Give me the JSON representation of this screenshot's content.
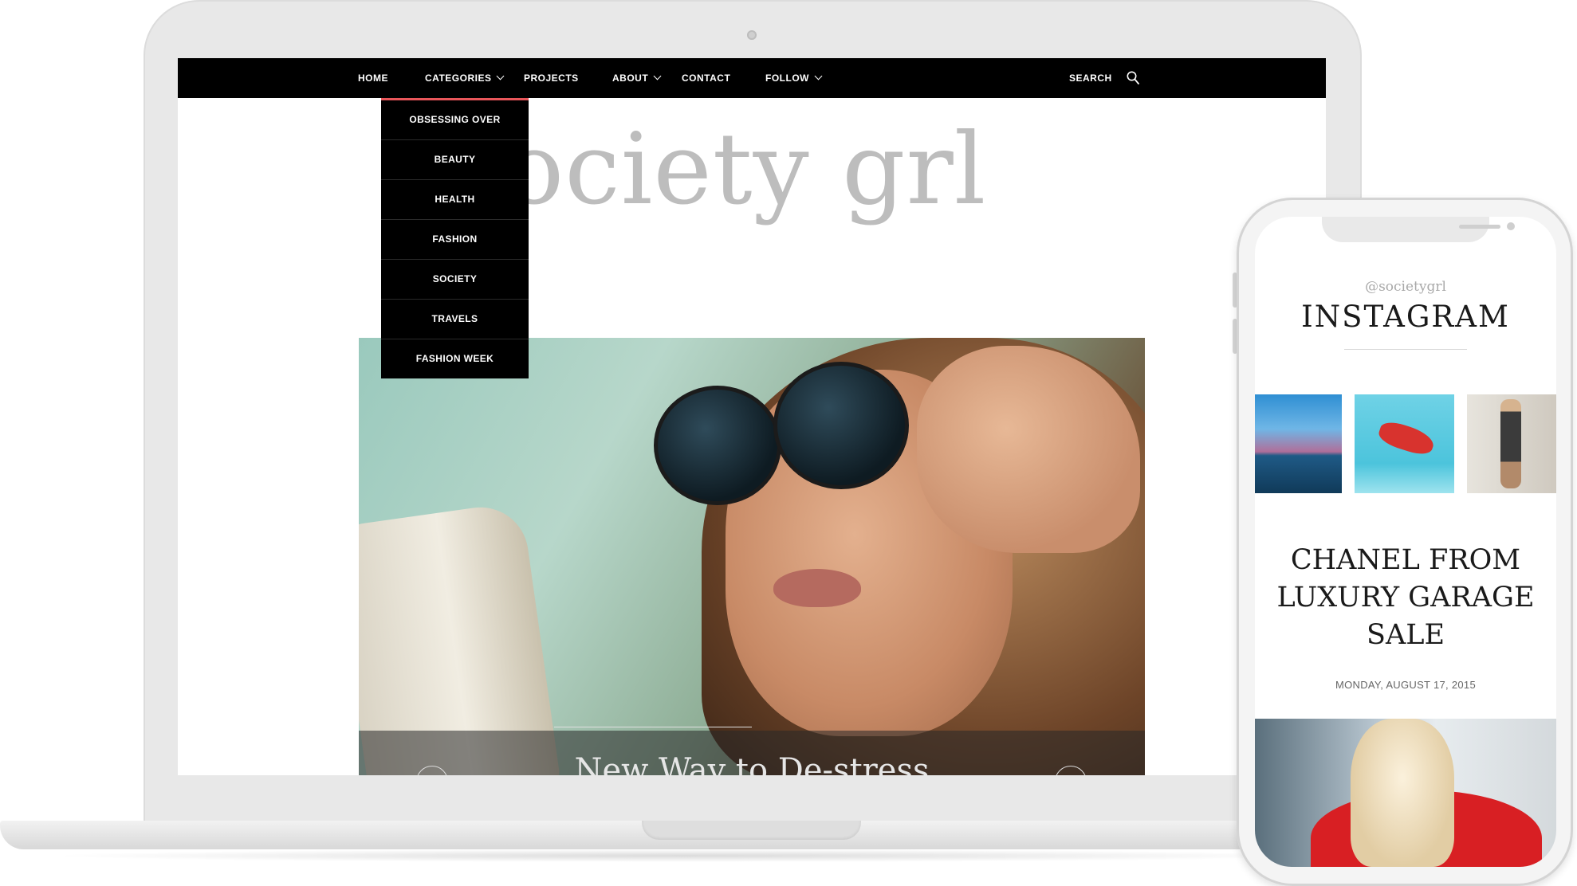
{
  "laptop": {
    "nav": {
      "home": "HOME",
      "categories": "CATEGORIES",
      "projects": "PROJECTS",
      "about": "ABOUT",
      "contact": "CONTACT",
      "follow": "FOLLOW",
      "search": "SEARCH"
    },
    "dropdown": {
      "items": [
        {
          "label": "OBSESSING OVER"
        },
        {
          "label": "BEAUTY"
        },
        {
          "label": "HEALTH"
        },
        {
          "label": "FASHION"
        },
        {
          "label": "SOCIETY"
        },
        {
          "label": "TRAVELS"
        },
        {
          "label": "FASHION WEEK"
        }
      ]
    },
    "site_title": "society grl",
    "hero": {
      "caption": "New Way to De-stress"
    }
  },
  "phone": {
    "instagram_handle": "@societygrl",
    "instagram_title": "INSTAGRAM",
    "post": {
      "title": "CHANEL FROM LUXURY GARAGE SALE",
      "date": "MONDAY, AUGUST 17, 2015"
    }
  },
  "colors": {
    "nav_background": "#000000",
    "dropdown_accent": "#e8565a",
    "site_title": "#bdbdbd"
  }
}
